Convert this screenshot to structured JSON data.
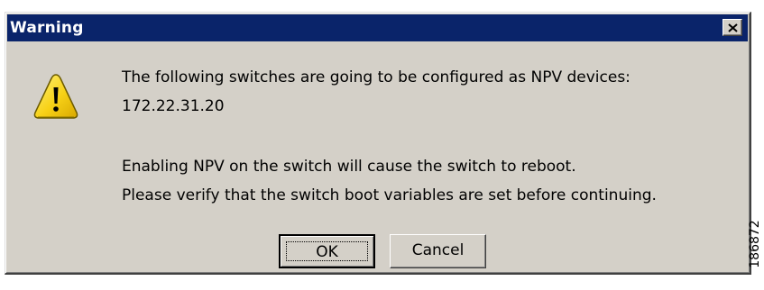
{
  "dialog": {
    "title": "Warning",
    "close_icon": "close-x-icon",
    "warning_icon": "warning-triangle-icon",
    "message": {
      "line1": "The following switches are going to be configured as NPV devices:",
      "line2": "172.22.31.20",
      "line3": "Enabling NPV on the switch will cause the switch to reboot.",
      "line4": "Please verify that the switch boot variables are set before continuing."
    },
    "buttons": {
      "ok_label": "OK",
      "cancel_label": "Cancel"
    }
  },
  "figure_id": "186872",
  "colors": {
    "titlebar": "#0a246a",
    "dialog_bg": "#d4d0c8",
    "warning_yellow": "#f7d117"
  }
}
